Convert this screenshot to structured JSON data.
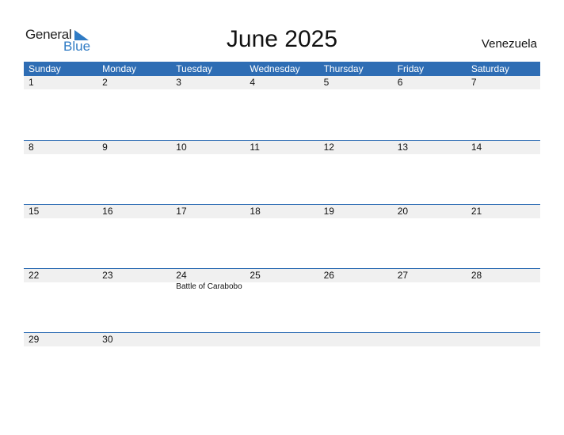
{
  "logo": {
    "line1": "General",
    "line2": "Blue"
  },
  "title": "June 2025",
  "country": "Venezuela",
  "colors": {
    "accent": "#2e6db4",
    "date_strip": "#f0f0f0"
  },
  "weekdays": [
    "Sunday",
    "Monday",
    "Tuesday",
    "Wednesday",
    "Thursday",
    "Friday",
    "Saturday"
  ],
  "weeks": [
    {
      "days": [
        "1",
        "2",
        "3",
        "4",
        "5",
        "6",
        "7"
      ],
      "events": [
        "",
        "",
        "",
        "",
        "",
        "",
        ""
      ]
    },
    {
      "days": [
        "8",
        "9",
        "10",
        "11",
        "12",
        "13",
        "14"
      ],
      "events": [
        "",
        "",
        "",
        "",
        "",
        "",
        ""
      ]
    },
    {
      "days": [
        "15",
        "16",
        "17",
        "18",
        "19",
        "20",
        "21"
      ],
      "events": [
        "",
        "",
        "",
        "",
        "",
        "",
        ""
      ]
    },
    {
      "days": [
        "22",
        "23",
        "24",
        "25",
        "26",
        "27",
        "28"
      ],
      "events": [
        "",
        "",
        "Battle of Carabobo",
        "",
        "",
        "",
        ""
      ]
    },
    {
      "days": [
        "29",
        "30",
        "",
        "",
        "",
        "",
        ""
      ],
      "events": [
        "",
        "",
        "",
        "",
        "",
        "",
        ""
      ]
    }
  ]
}
